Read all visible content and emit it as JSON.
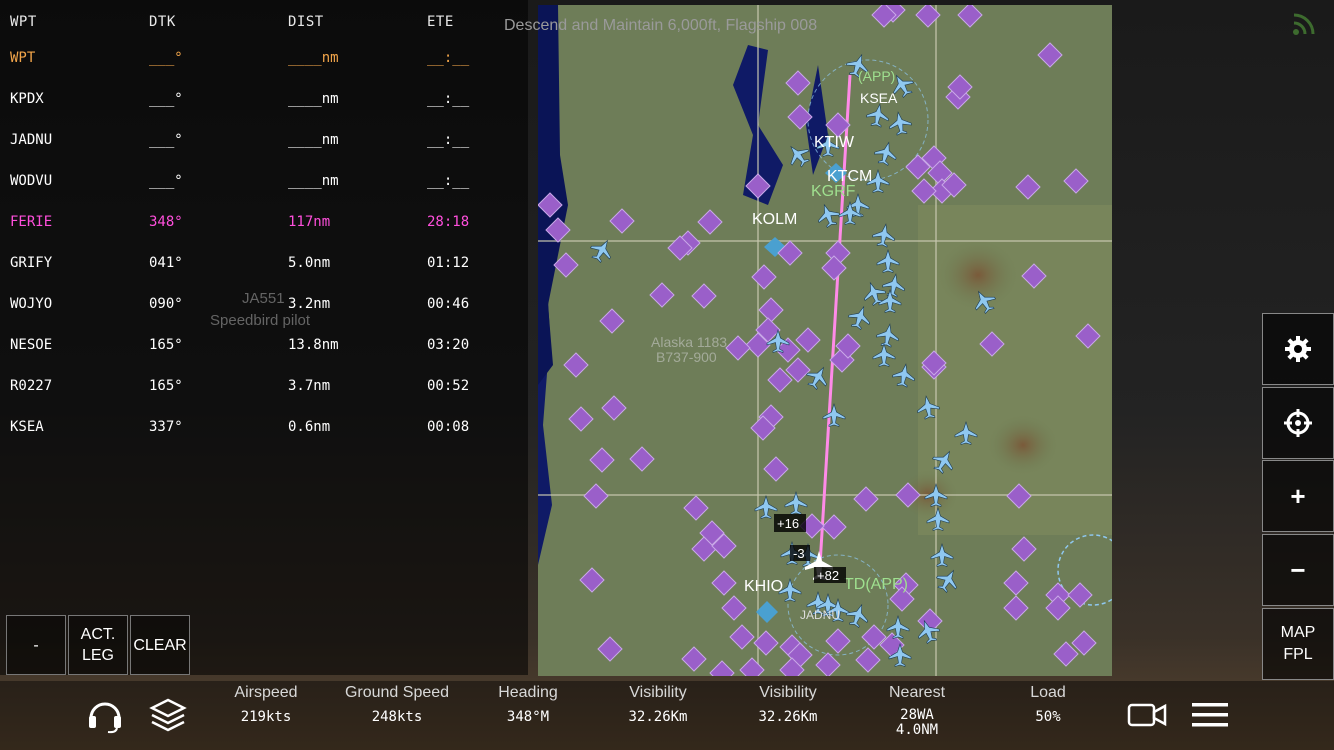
{
  "instruction": "Descend and Maintain 6,000ft, Flagship 008",
  "flight_plan": {
    "headers": {
      "wpt": "WPT",
      "dtk": "DTK",
      "dist": "DIST",
      "ete": "ETE"
    },
    "rows": [
      {
        "wpt": "WPT",
        "dtk": "___°",
        "dist": "____nm",
        "ete": "__:__",
        "style": "orange"
      },
      {
        "wpt": "KPDX",
        "dtk": "___°",
        "dist": "____nm",
        "ete": "__:__",
        "style": "white"
      },
      {
        "wpt": "JADNU",
        "dtk": "___°",
        "dist": "____nm",
        "ete": "__:__",
        "style": "white"
      },
      {
        "wpt": "WODVU",
        "dtk": "___°",
        "dist": "____nm",
        "ete": "__:__",
        "style": "white"
      },
      {
        "wpt": "FERIE",
        "dtk": "348°",
        "dist": "117nm",
        "ete": "28:18",
        "style": "magenta"
      },
      {
        "wpt": "GRIFY",
        "dtk": "041°",
        "dist": "5.0nm",
        "ete": "01:12",
        "style": "white"
      },
      {
        "wpt": "WOJYO",
        "dtk": "090°",
        "dist": "3.2nm",
        "ete": "00:46",
        "style": "white"
      },
      {
        "wpt": "NESOE",
        "dtk": "165°",
        "dist": "13.8nm",
        "ete": "03:20",
        "style": "white"
      },
      {
        "wpt": "R0227",
        "dtk": "165°",
        "dist": "3.7nm",
        "ete": "00:52",
        "style": "white"
      },
      {
        "wpt": "KSEA",
        "dtk": "337°",
        "dist": "0.6nm",
        "ete": "00:08",
        "style": "white"
      }
    ],
    "buttons": {
      "minus": "-",
      "act_leg_1": "ACT.",
      "act_leg_2": "LEG",
      "clear": "CLEAR"
    }
  },
  "map": {
    "labels": {
      "ktiw": "KTIW",
      "ktcm": "KTCM",
      "kgrf": "KGRF",
      "kolm": "KOLM",
      "khio": "KHIO",
      "kpdx_app": "TD(APP)",
      "ksea": "KSEA",
      "app_top": "(APP)",
      "jadnu": "JADNU",
      "tag1": "+16",
      "tag2": "-3",
      "tag3": "+82",
      "ghost1": "Alaska 1183",
      "ghost2": "B737-900",
      "ghost3": "JA551",
      "ghost4": "Speedbird pilot"
    }
  },
  "controls": {
    "map_label": "MAP",
    "fpl_label": "FPL",
    "plus": "+",
    "minus": "−"
  },
  "stats": [
    {
      "label": "Airspeed",
      "value": "219kts"
    },
    {
      "label": "Ground Speed",
      "value": "248kts"
    },
    {
      "label": "Heading",
      "value": "348°M"
    },
    {
      "label": "Visibility",
      "value": "32.26Km"
    },
    {
      "label": "Visibility",
      "value": "32.26Km"
    },
    {
      "label": "Nearest",
      "value": "28WA",
      "value2": "4.0NM"
    },
    {
      "label": "Load",
      "value": "50%"
    }
  ],
  "colors": {
    "magenta": "#ff4fdc",
    "orange": "#f2a54a",
    "aircraft": "#8fc8f0",
    "airport": "#9a5fc9"
  }
}
